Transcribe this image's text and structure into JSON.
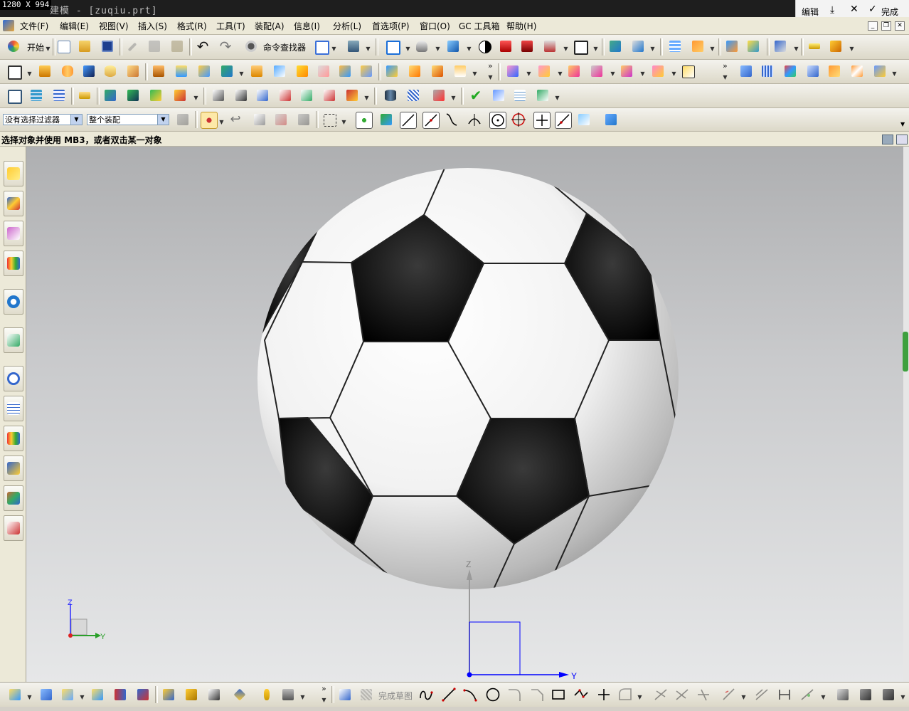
{
  "titlebar": {
    "dims": "1280 X 994",
    "title": "建模 - [zuqiu.prt]",
    "sketch_edit": "编辑",
    "sketch_finish": "完成"
  },
  "menu": {
    "file": "文件(F)",
    "edit": "编辑(E)",
    "view": "视图(V)",
    "insert": "插入(S)",
    "format": "格式(R)",
    "tools": "工具(T)",
    "assemblies": "装配(A)",
    "information": "信息(I)",
    "analysis": "分析(L)",
    "preferences": "首选项(P)",
    "window": "窗口(O)",
    "gc_toolkit": "GC 工具箱",
    "help": "帮助(H)"
  },
  "toolbar1": {
    "start": "开始",
    "command_finder": "命令查找器"
  },
  "selection": {
    "filter_value": "没有选择过滤器",
    "scope_value": "整个装配"
  },
  "cue": "选择对象并使用 MB3，或者双击某一对象",
  "viewport": {
    "axis_z": "Z",
    "axis_y": "Y",
    "small_axis_z": "Z",
    "small_axis_y": "Y"
  },
  "bottombar": {
    "finish_sketch": "完成草图"
  },
  "colors": {
    "accent": "#0000ff",
    "ball_black": "#050505",
    "ball_white": "#ffffff"
  },
  "icons": [
    "start-icon",
    "new-icon",
    "open-icon",
    "save-icon",
    "cut-icon",
    "copy-icon",
    "paste-icon",
    "undo-icon",
    "redo-icon",
    "command-finder-icon",
    "fit-icon",
    "select-icon",
    "render-style-icon",
    "shaded-icon",
    "wireframe-icon",
    "layer-icon",
    "sketch-icon",
    "extrude-icon",
    "revolve-icon",
    "block-icon",
    "cylinder-icon",
    "hole-icon",
    "edge-blend-icon",
    "chamfer-icon",
    "line-icon",
    "arc-icon",
    "circle-icon",
    "point-icon",
    "resource-bar-icons"
  ]
}
